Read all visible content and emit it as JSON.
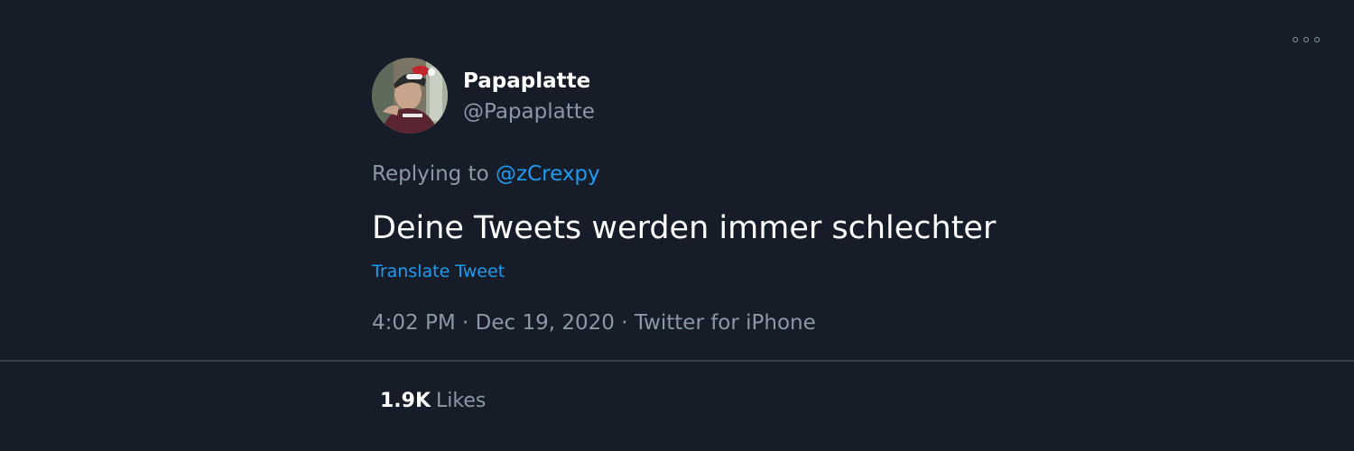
{
  "tweet": {
    "author": {
      "display_name": "Papaplatte",
      "handle": "@Papaplatte"
    },
    "replying_prefix": "Replying to",
    "replying_to": "@zCrexpy",
    "text": "Deine Tweets werden immer schlechter",
    "translate_label": "Translate Tweet",
    "time": "4:02 PM",
    "separator": "·",
    "date": "Dec 19, 2020",
    "source": "Twitter for iPhone"
  },
  "stats": {
    "likes_count": "1.9K",
    "likes_label": "Likes"
  },
  "icons": {
    "more": "more-options-icon"
  },
  "colors": {
    "background": "#161d28",
    "link": "#1d9bf0",
    "secondary_text": "#8b98a5",
    "primary_text": "#ffffff"
  }
}
